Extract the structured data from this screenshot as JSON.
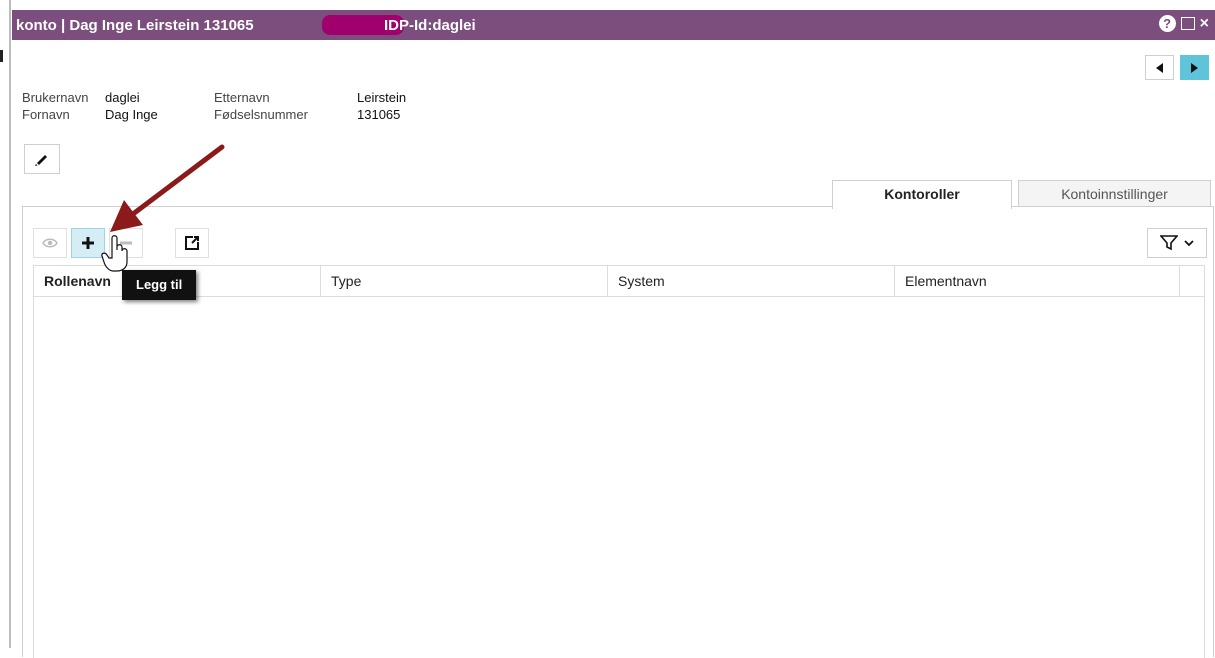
{
  "window": {
    "title_prefix": "konto | Dag Inge Leirstein 131065",
    "title_id": "IDP-Id:daglei",
    "colors": {
      "titlebar": "#7b4e7e",
      "accent": "#5fc3d9",
      "redaction": "#a0006e",
      "arrow": "#8b1a1a"
    }
  },
  "user": {
    "username_label": "Brukernavn",
    "username_value": "daglei",
    "firstname_label": "Fornavn",
    "firstname_value": "Dag Inge",
    "lastname_label": "Etternavn",
    "lastname_value": "Leirstein",
    "ssn_label": "Fødselsnummer",
    "ssn_value": "131065"
  },
  "tabs": [
    {
      "label": "Kontoroller",
      "active": true
    },
    {
      "label": "Kontoinnstillinger",
      "active": false
    }
  ],
  "toolbar": {
    "icons": [
      "eye-icon",
      "plus-icon",
      "minus-icon",
      "external-link-icon"
    ],
    "filter_icons": [
      "funnel-icon",
      "chevron-down-icon"
    ]
  },
  "table": {
    "columns": [
      "Rollenavn",
      "Type",
      "System",
      "Elementnavn"
    ],
    "rows": []
  },
  "tooltip": {
    "text": "Legg til"
  }
}
